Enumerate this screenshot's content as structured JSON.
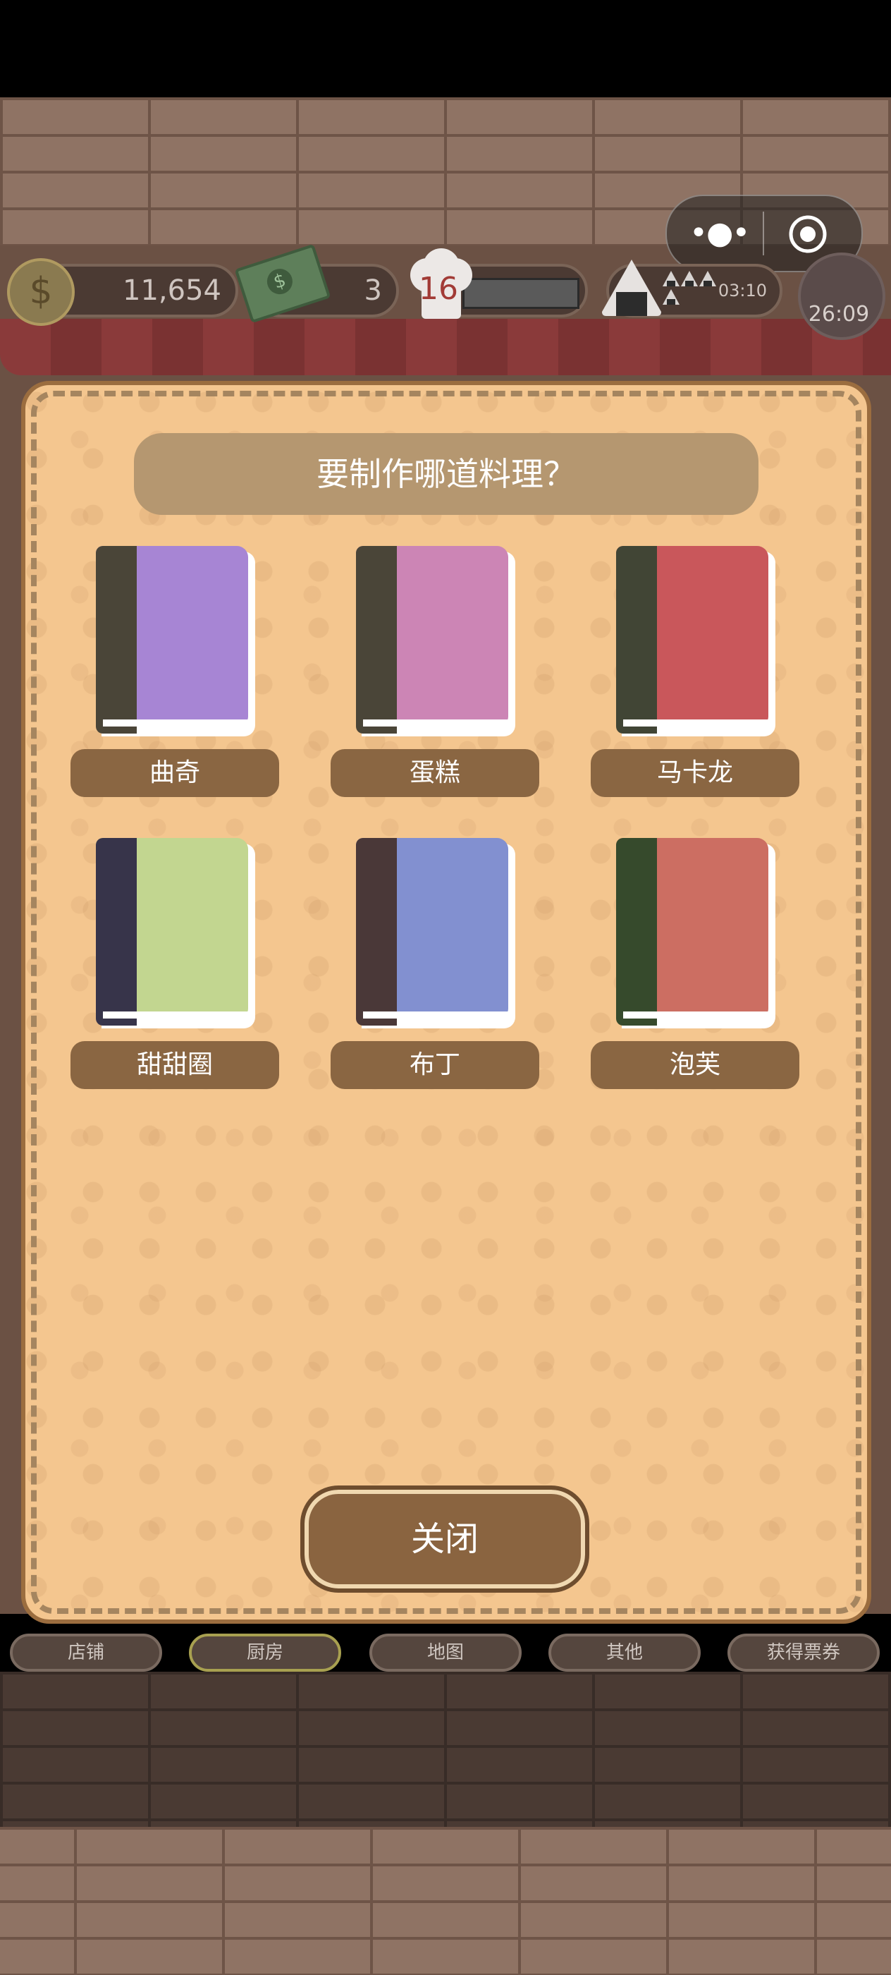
{
  "hud": {
    "coins": "11,654",
    "cash": "3",
    "level": "16",
    "timer": "03:10",
    "flower_timer": "26:09"
  },
  "dialog": {
    "title": "要制作哪道料理？",
    "recipes": [
      {
        "label": "曲奇",
        "cover_color": "#a785d4",
        "spine_color": "#4a4538"
      },
      {
        "label": "蛋糕",
        "cover_color": "#cc85b5",
        "spine_color": "#4a4538"
      },
      {
        "label": "马卡龙",
        "cover_color": "#c9575b",
        "spine_color": "#414535"
      },
      {
        "label": "甜甜圈",
        "cover_color": "#c2d690",
        "spine_color": "#37344a"
      },
      {
        "label": "布丁",
        "cover_color": "#8290d0",
        "spine_color": "#4a3838"
      },
      {
        "label": "泡芙",
        "cover_color": "#cc6e62",
        "spine_color": "#364a2c"
      }
    ],
    "close_label": "关闭"
  },
  "nav": {
    "items": [
      "店铺",
      "厨房",
      "地图",
      "其他",
      "获得票券"
    ],
    "active": "厨房"
  },
  "capsule": {
    "menu_icon": "more-dots-icon",
    "close_icon": "target-circle-icon"
  }
}
